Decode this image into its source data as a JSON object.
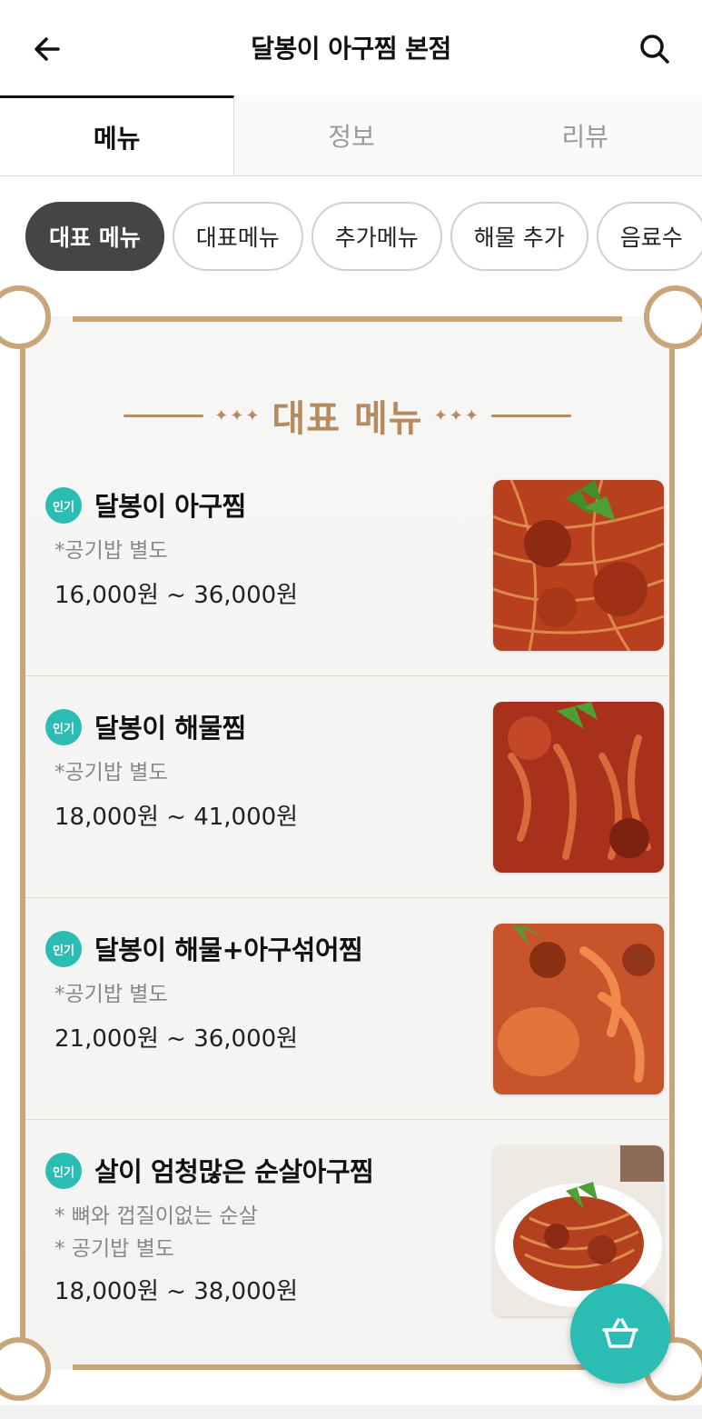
{
  "header": {
    "title": "달봉이 아구찜 본점"
  },
  "tabs": [
    {
      "label": "메뉴",
      "active": true
    },
    {
      "label": "정보",
      "active": false
    },
    {
      "label": "리뷰",
      "active": false
    }
  ],
  "chips": [
    {
      "label": "대표 메뉴",
      "active": true
    },
    {
      "label": "대표메뉴",
      "active": false
    },
    {
      "label": "추가메뉴",
      "active": false
    },
    {
      "label": "해물 추가",
      "active": false
    },
    {
      "label": "음료수",
      "active": false
    }
  ],
  "section": {
    "heading": "대표 메뉴",
    "ornament_left": "✦✦✦",
    "ornament_right": "✦✦✦"
  },
  "menu_items": [
    {
      "badge": "인기",
      "name": "달봉이 아구찜",
      "notes": [
        "*공기밥 별도"
      ],
      "price": "16,000원 ~ 36,000원"
    },
    {
      "badge": "인기",
      "name": "달봉이 해물찜",
      "notes": [
        "*공기밥 별도"
      ],
      "price": "18,000원 ~ 41,000원"
    },
    {
      "badge": "인기",
      "name": "달봉이 해물+아구섞어찜",
      "notes": [
        "*공기밥 별도"
      ],
      "price": "21,000원 ~ 36,000원"
    },
    {
      "badge": "인기",
      "name": "살이 엄청많은 순살아구찜",
      "notes": [
        "* 뼈와 껍질이없는 순살",
        "* 공기밥 별도"
      ],
      "price": "18,000원 ~ 38,000원"
    }
  ],
  "colors": {
    "accent": "#2bbcb3",
    "gold": "#c9a57a",
    "chip_active": "#454545"
  },
  "icons": {
    "back": "arrow-left-icon",
    "search": "search-icon",
    "cart": "basket-icon"
  }
}
